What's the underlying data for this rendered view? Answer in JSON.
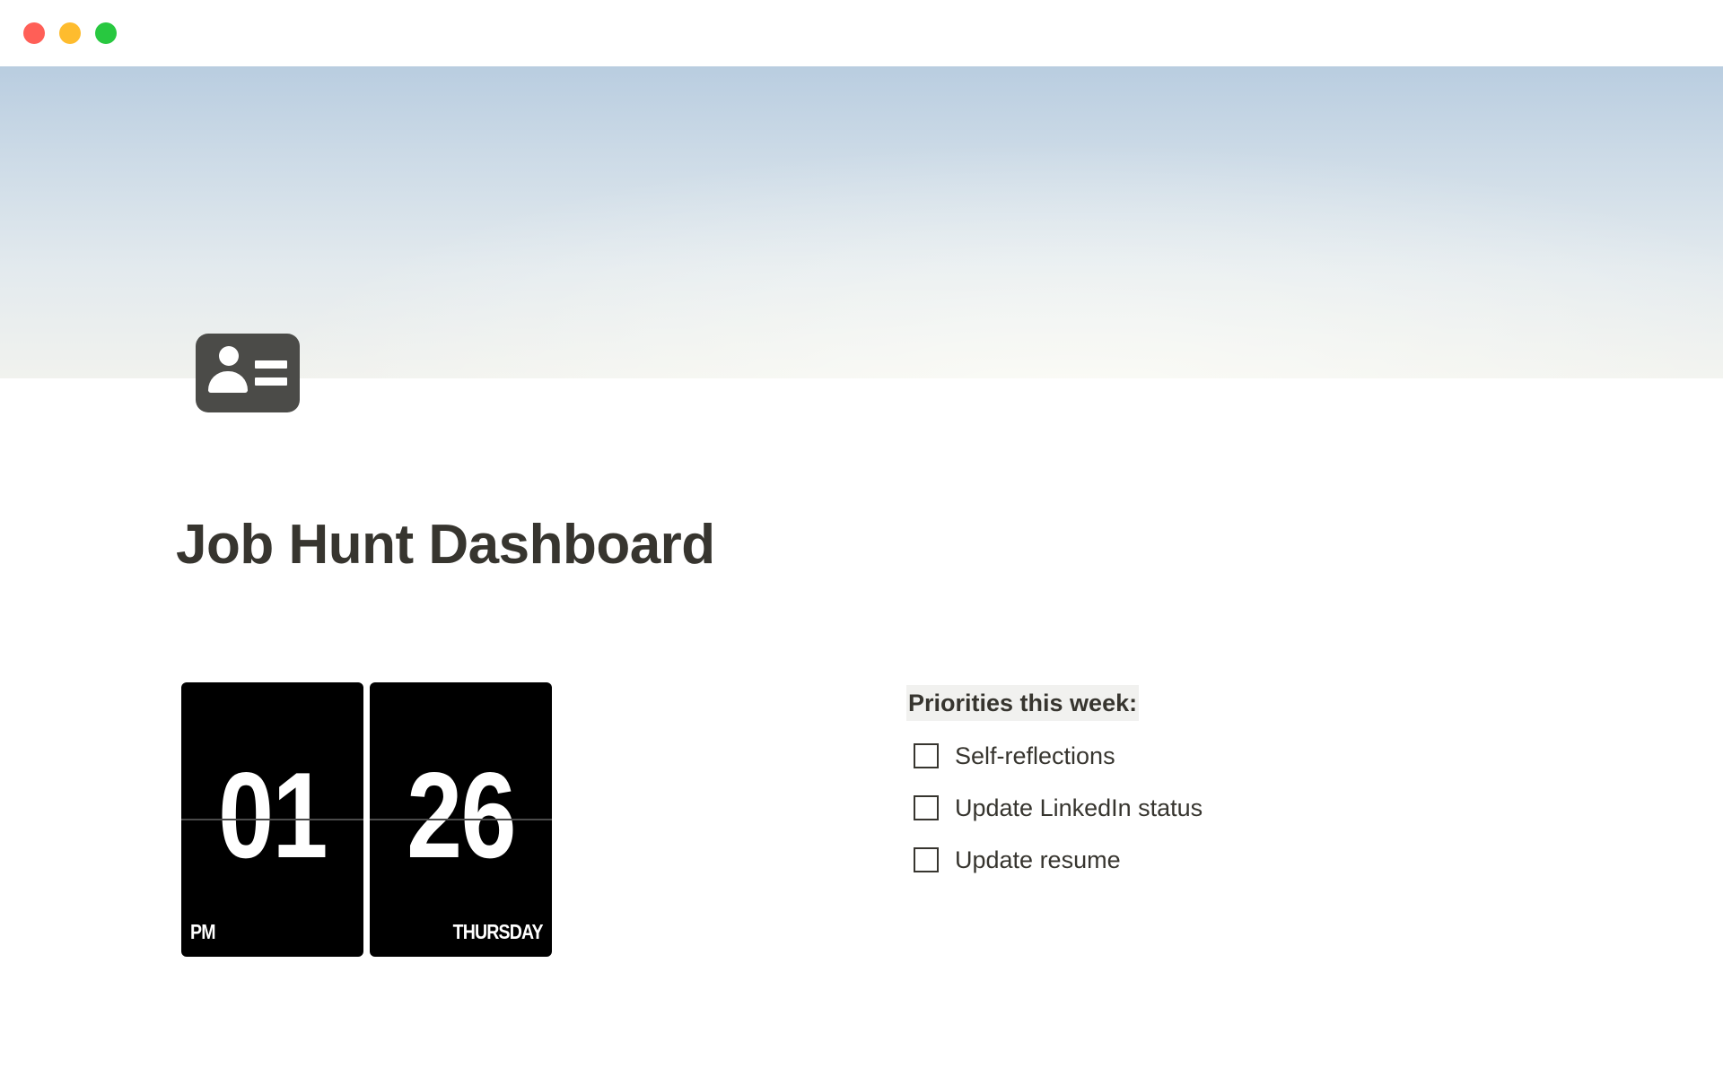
{
  "window": {
    "controls": [
      "close",
      "minimize",
      "maximize"
    ],
    "colors": {
      "close": "#ff5f57",
      "minimize": "#febc2e",
      "maximize": "#28c840"
    }
  },
  "cover": {
    "description_icon": "cover-image"
  },
  "page": {
    "icon": "contact-card-icon",
    "title": "Job Hunt Dashboard"
  },
  "clock": {
    "hours": "01",
    "minutes": "26",
    "period": "PM",
    "day": "THURSDAY"
  },
  "priorities": {
    "heading": "Priorities this week:",
    "items": [
      {
        "label": "Self-reflections",
        "checked": false
      },
      {
        "label": "Update LinkedIn status",
        "checked": false
      },
      {
        "label": "Update resume",
        "checked": false
      }
    ]
  },
  "colors": {
    "text": "#37352f",
    "clock_bg": "#000000",
    "heading_highlight": "#f1f1ef"
  }
}
